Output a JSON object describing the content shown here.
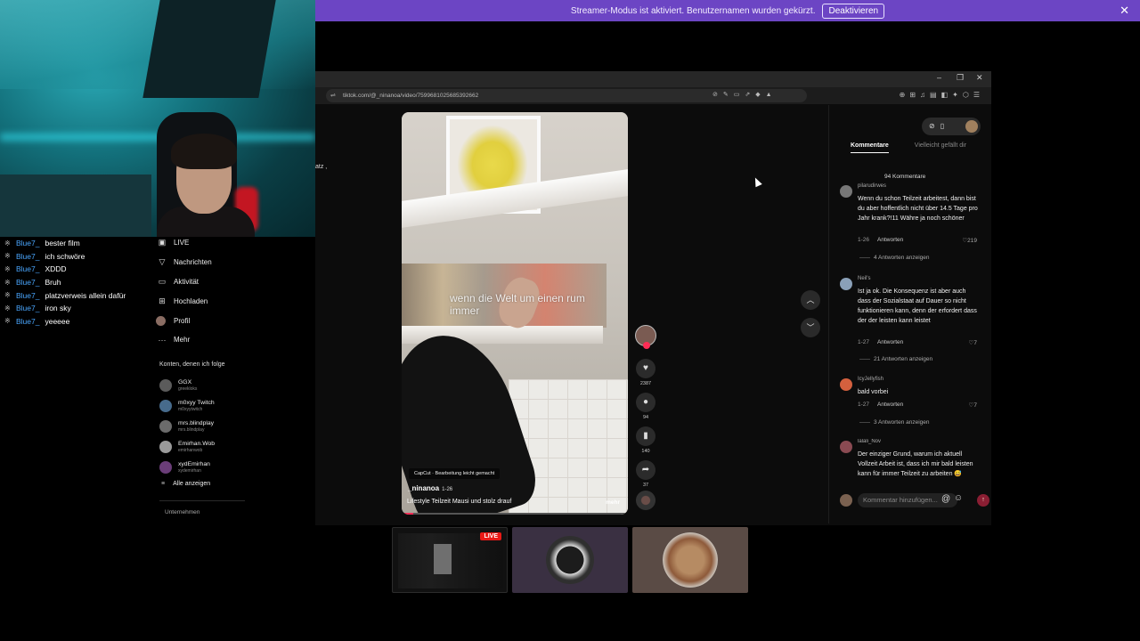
{
  "banner": {
    "text": "Streamer-Modus ist aktiviert. Benutzernamen wurden gekürzt.",
    "button": "Deaktivieren",
    "close_icon": "close-icon",
    "color": "#6c45c4"
  },
  "chat": {
    "messages": [
      {
        "user": "Blue7_",
        "text": "bester film"
      },
      {
        "user": "Blue7_",
        "text": "ich schwöre"
      },
      {
        "user": "Blue7_",
        "text": "XDDD"
      },
      {
        "user": "Blue7_",
        "text": "Bruh"
      },
      {
        "user": "Blue7_",
        "text": "platzverweis allein dafür"
      },
      {
        "user": "Blue7_",
        "text": "iron sky"
      },
      {
        "user": "Blue7_",
        "text": "yeeeee"
      }
    ],
    "username_color": "#4aa7ff"
  },
  "browser": {
    "url": "tiktok.com/@_ninanoa/video/7599681025685392662"
  },
  "nav": {
    "items": [
      {
        "label": "LIVE",
        "icon": "live-icon"
      },
      {
        "label": "Nachrichten",
        "icon": "messages-icon"
      },
      {
        "label": "Aktivität",
        "icon": "activity-icon"
      },
      {
        "label": "Hochladen",
        "icon": "upload-icon"
      },
      {
        "label": "Profil",
        "icon": "profile-avatar"
      },
      {
        "label": "Mehr",
        "icon": "more-icon"
      }
    ],
    "following_heading": "Konten, denen ich folge",
    "following": [
      {
        "name": "GGX",
        "handle": "greekloks"
      },
      {
        "name": "m0xyy Twitch",
        "handle": "m0xyytwitch"
      },
      {
        "name": "mrs.blindplay",
        "handle": "mrs.blindplay"
      },
      {
        "name": "Emirhan.Wob",
        "handle": "emirhanwob"
      },
      {
        "name": "xydEmirhan",
        "handle": "xydemirhan"
      }
    ],
    "show_all": "Alle anzeigen",
    "company": "Unternehmen",
    "stray_text": "atz ,"
  },
  "video": {
    "caption": "wenn die Welt um einen rum immer",
    "capcut": "CapCut · Bearbeitung leicht gemacht",
    "author": "_ninanoa",
    "date": "1-26",
    "description": "Lifestyle Teilzeit Mausi und stolz drauf",
    "more": "mehr",
    "progress": 0.05,
    "likes": "2387",
    "comments": "94",
    "saves": "140",
    "shares": "37"
  },
  "comments_panel": {
    "tab_active": "Kommentare",
    "tab_other": "Vielleicht gefällt dir",
    "count": "94 Kommentare",
    "comments": [
      {
        "user": "pilarudirwes",
        "text": "Wenn du schon Teilzeit arbeitest, dann bist du aber hoffentlich nicht über 14.5 Tage pro Jahr krank?!11 Währe ja noch schöner",
        "date": "1-26",
        "reply": "Antworten",
        "likes": "219",
        "more": "4 Antworten anzeigen"
      },
      {
        "user": "Neil's",
        "text": "Ist ja ok. Die Konsequenz ist aber auch dass der Sozialstaat auf Dauer so nicht funktionieren kann, denn der erfordert dass der der leisten kann leistet",
        "date": "1-27",
        "reply": "Antworten",
        "likes": "7",
        "more": "21 Antworten anzeigen"
      },
      {
        "user": "IcyJellyfish",
        "text": "bald vorbei",
        "date": "1-27",
        "reply": "Antworten",
        "likes": "7",
        "more": "3 Antworten anzeigen"
      },
      {
        "user": "lalali_Nov",
        "text": "Der einziger Grund, warum ich aktuell Vollzeit Arbeit ist, dass ich mir bald leisten kann für immer Teilzeit zu arbeiten 😅",
        "date": "",
        "reply": "",
        "likes": "",
        "more": ""
      }
    ],
    "input_placeholder": "Kommentar hinzufügen..."
  },
  "thumbnails": {
    "live_badge": "LIVE"
  }
}
